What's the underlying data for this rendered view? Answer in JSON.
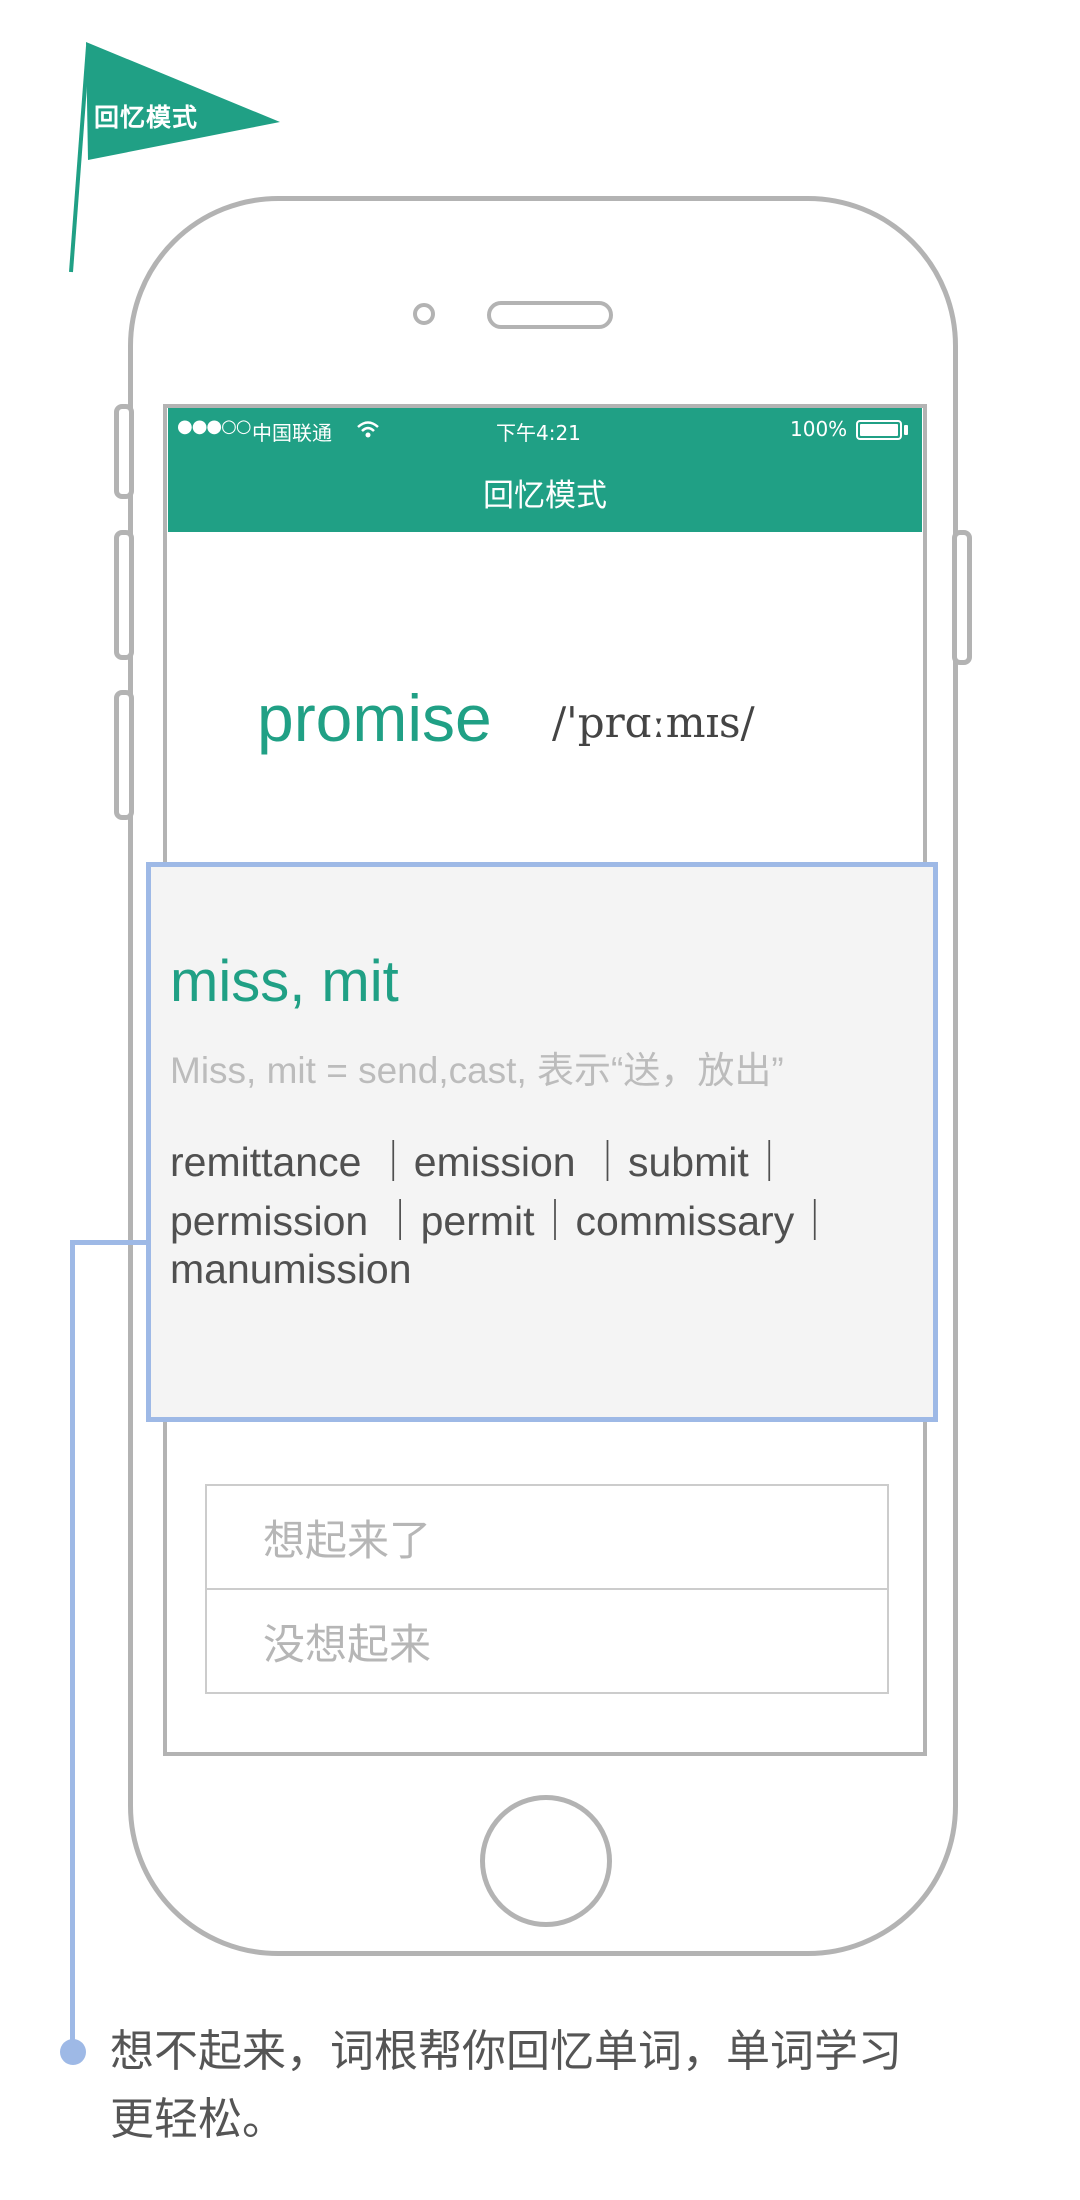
{
  "flag": {
    "label": "回忆模式"
  },
  "status_bar": {
    "signal": "●●●○○",
    "carrier": "中国联通",
    "time": "下午4:21",
    "battery": "100%"
  },
  "nav": {
    "title": "回忆模式"
  },
  "word": {
    "text": "promise",
    "phonetic": "/'prɑːmɪs/"
  },
  "root_card": {
    "title": "miss, mit",
    "description": "Miss, mit = send,cast, 表示“送，放出”",
    "examples": [
      "remittance ｜emission ｜submit｜",
      "permission ｜permit｜commissary｜",
      "manumission"
    ]
  },
  "answers": {
    "remembered": "想起来了",
    "forgot": "没想起来"
  },
  "caption": "想不起来，词根帮你回忆单词，单词学习更轻松。",
  "colors": {
    "accent": "#20a085",
    "callout": "#9eb9e6",
    "frame": "#b3b3b3"
  }
}
